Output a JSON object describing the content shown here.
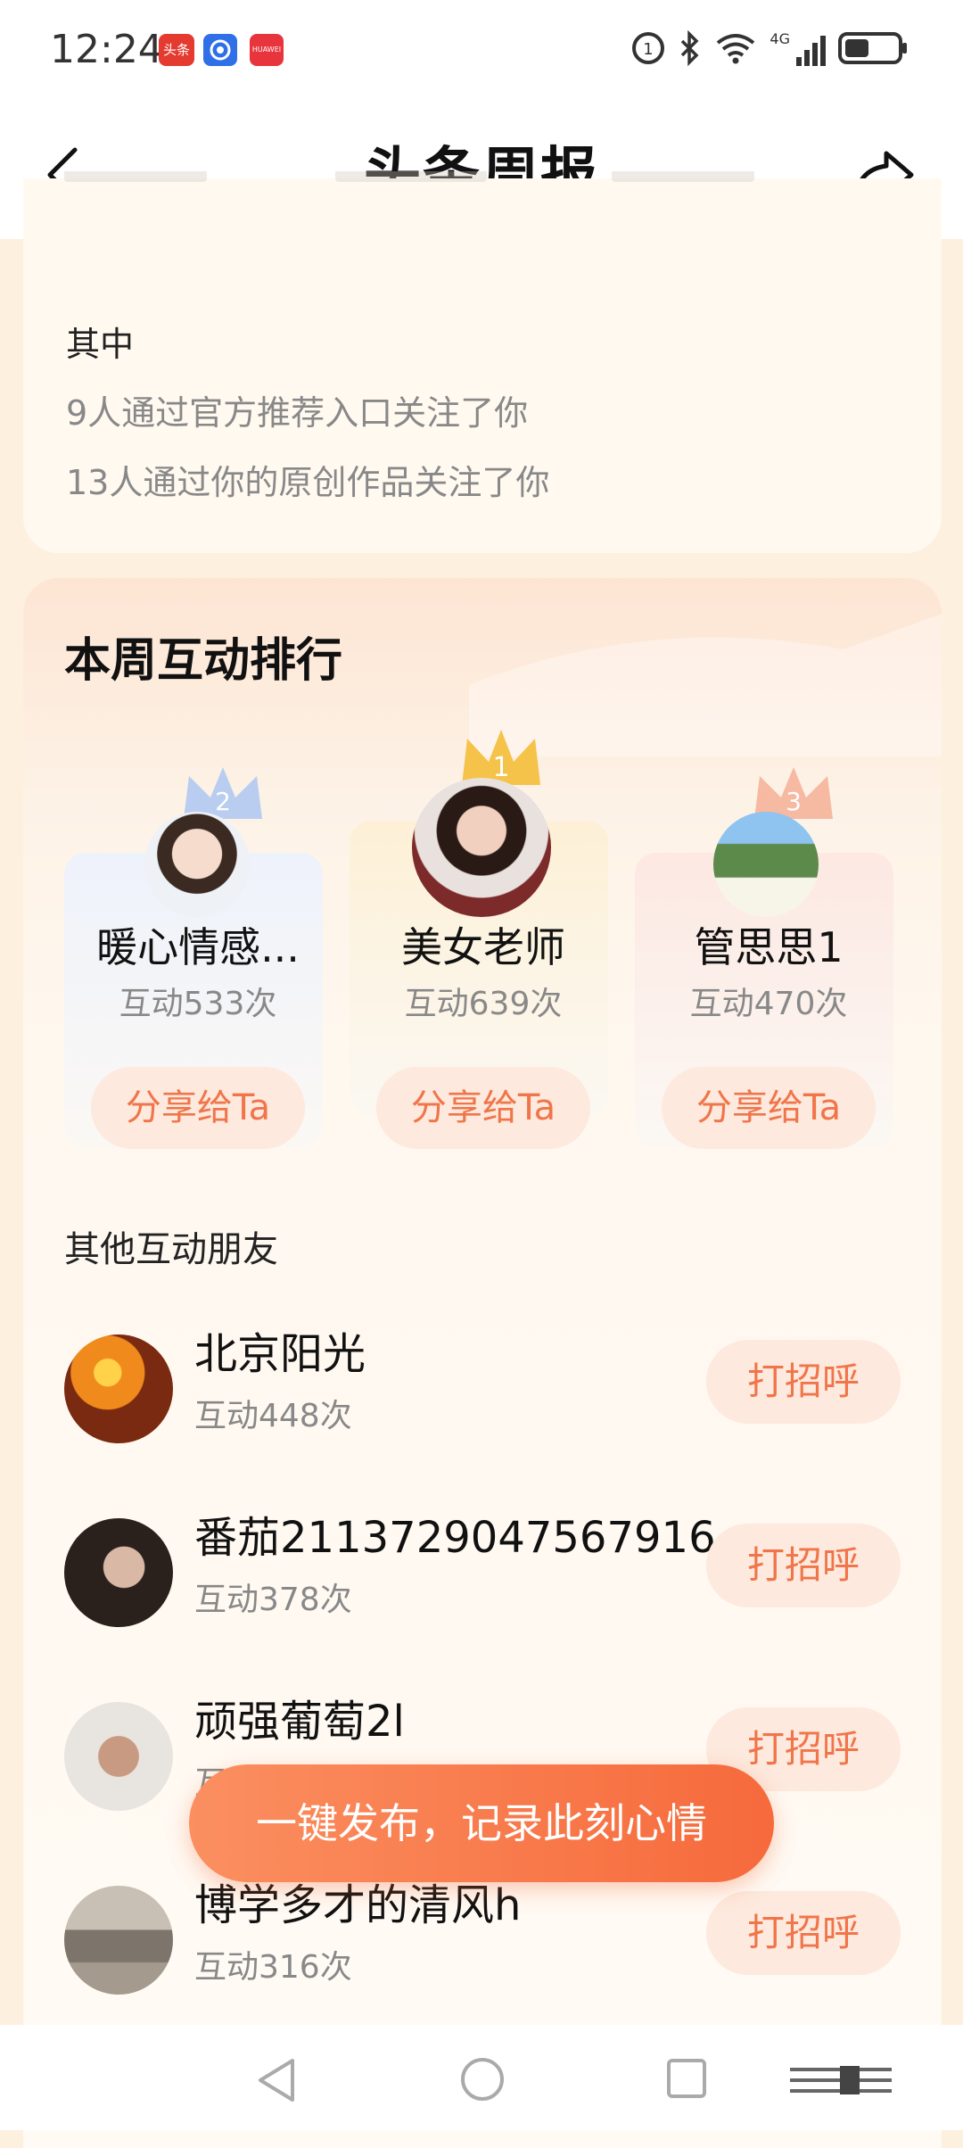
{
  "status": {
    "time": "12:24",
    "badge1": "头条",
    "badge3": "HUAWEI",
    "network": "4G"
  },
  "nav": {
    "title": "头条周报"
  },
  "card1": {
    "heading": "其中",
    "lines": [
      "9人通过官方推荐入口关注了你",
      "13人通过你的原创作品关注了你"
    ]
  },
  "interaction": {
    "title": "本周互动排行",
    "top": [
      {
        "rank": "2",
        "name": "暖心情感...",
        "count": "互动533次",
        "button": "分享给Ta"
      },
      {
        "rank": "1",
        "name": "美女老师",
        "count": "互动639次",
        "button": "分享给Ta"
      },
      {
        "rank": "3",
        "name": "管思思1",
        "count": "互动470次",
        "button": "分享给Ta"
      }
    ],
    "others_title": "其他互动朋友",
    "others": [
      {
        "name": "北京阳光",
        "count": "互动448次",
        "button": "打招呼"
      },
      {
        "name": "番茄2113729047567916",
        "count": "互动378次",
        "button": "打招呼"
      },
      {
        "name": "顽强葡萄2l",
        "count": "互动",
        "button": "打招呼"
      },
      {
        "name": "博学多才的清风h",
        "count": "互动316次",
        "button": "打招呼"
      }
    ]
  },
  "fab": {
    "label": "一键发布，记录此刻心情"
  }
}
